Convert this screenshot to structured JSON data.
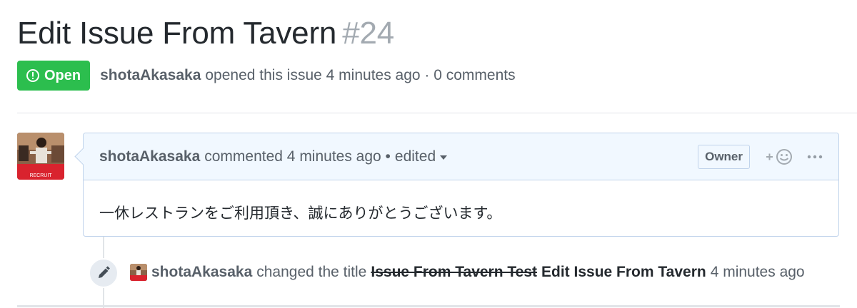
{
  "issue": {
    "title": "Edit Issue From Tavern",
    "number": "#24",
    "state_label": "Open",
    "state_color": "#2cbe4e",
    "author": "shotaAkasaka",
    "meta_text": "opened this issue 4 minutes ago · 0 comments"
  },
  "comment": {
    "author": "shotaAkasaka",
    "action_text": "commented 4 minutes ago •",
    "edited_label": "edited",
    "role_label": "Owner",
    "reaction_icon": "smiley-plus-icon",
    "more_icon": "kebab-horizontal-icon",
    "body": "一休レストランをご利用頂き、誠にありがとうございます。",
    "avatar_brand_text": "RECRUIT",
    "header_bg": "#f1f8ff",
    "border_color": "#c0d3eb"
  },
  "event": {
    "icon": "pencil-icon",
    "author": "shotaAkasaka",
    "action_text": "changed the title",
    "old_title": "Issue From Tavern Test",
    "new_title": "Edit Issue From Tavern",
    "time_text": "4 minutes ago"
  }
}
